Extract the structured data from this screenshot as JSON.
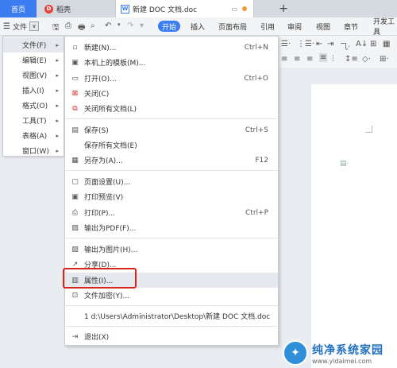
{
  "tabs": {
    "home": "首页",
    "daoke": "稻壳",
    "doc": "新建 DOC 文档.doc",
    "add": "+"
  },
  "toolbar": {
    "file_label": "文件",
    "ribbon_tabs": [
      "开始",
      "插入",
      "页面布局",
      "引用",
      "审阅",
      "视图",
      "章节",
      "开发工具"
    ]
  },
  "submenu": {
    "items": [
      {
        "label": "文件(F)"
      },
      {
        "label": "编辑(E)"
      },
      {
        "label": "视图(V)"
      },
      {
        "label": "插入(I)"
      },
      {
        "label": "格式(O)"
      },
      {
        "label": "工具(T)"
      },
      {
        "label": "表格(A)"
      },
      {
        "label": "窗口(W)"
      }
    ]
  },
  "menu": {
    "items": [
      {
        "label": "新建(N)...",
        "shortcut": "Ctrl+N",
        "icon": "new-file-icon"
      },
      {
        "label": "本机上的模板(M)...",
        "shortcut": "",
        "icon": "template-icon"
      },
      {
        "label": "打开(O)...",
        "shortcut": "Ctrl+O",
        "icon": "open-folder-icon"
      },
      {
        "label": "关闭(C)",
        "shortcut": "",
        "icon": "close-doc-icon"
      },
      {
        "label": "关闭所有文档(L)",
        "shortcut": "",
        "icon": "close-all-icon"
      },
      {
        "label": "保存(S)",
        "shortcut": "Ctrl+S",
        "icon": "save-icon"
      },
      {
        "label": "保存所有文档(E)",
        "shortcut": "",
        "icon": ""
      },
      {
        "label": "另存为(A)...",
        "shortcut": "F12",
        "icon": "save-as-icon"
      },
      {
        "label": "页面设置(U)...",
        "shortcut": "",
        "icon": "page-setup-icon"
      },
      {
        "label": "打印预览(V)",
        "shortcut": "",
        "icon": "print-preview-icon"
      },
      {
        "label": "打印(P)...",
        "shortcut": "Ctrl+P",
        "icon": "print-icon"
      },
      {
        "label": "输出为PDF(F)...",
        "shortcut": "",
        "icon": "pdf-icon"
      },
      {
        "label": "输出为图片(H)...",
        "shortcut": "",
        "icon": "image-export-icon"
      },
      {
        "label": "分享(D)...",
        "shortcut": "",
        "icon": "share-icon"
      },
      {
        "label": "属性(I)...",
        "shortcut": "",
        "icon": "properties-icon"
      },
      {
        "label": "文件加密(Y)...",
        "shortcut": "",
        "icon": "encrypt-icon"
      },
      {
        "label": "1 d:\\Users\\Administrator\\Desktop\\新建 DOC 文档.doc",
        "shortcut": "",
        "icon": ""
      },
      {
        "label": "退出(X)",
        "shortcut": "",
        "icon": "exit-icon"
      }
    ]
  },
  "watermark": {
    "title": "纯净系统家园",
    "url": "www.yidaimei.com"
  },
  "colors": {
    "accent": "#3b7cf0",
    "highlight": "#d8261e"
  }
}
